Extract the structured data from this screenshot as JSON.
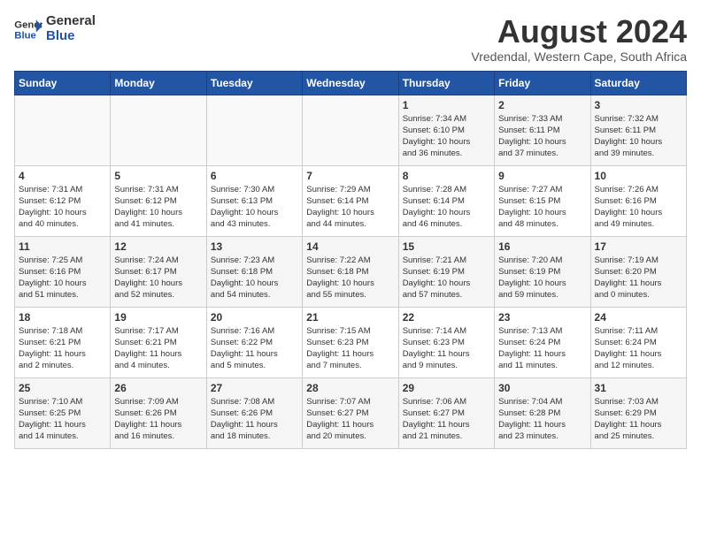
{
  "logo": {
    "text_general": "General",
    "text_blue": "Blue"
  },
  "title": {
    "month_year": "August 2024",
    "location": "Vredendal, Western Cape, South Africa"
  },
  "days_of_week": [
    "Sunday",
    "Monday",
    "Tuesday",
    "Wednesday",
    "Thursday",
    "Friday",
    "Saturday"
  ],
  "weeks": [
    [
      {
        "day": "",
        "info": ""
      },
      {
        "day": "",
        "info": ""
      },
      {
        "day": "",
        "info": ""
      },
      {
        "day": "",
        "info": ""
      },
      {
        "day": "1",
        "info": "Sunrise: 7:34 AM\nSunset: 6:10 PM\nDaylight: 10 hours\nand 36 minutes."
      },
      {
        "day": "2",
        "info": "Sunrise: 7:33 AM\nSunset: 6:11 PM\nDaylight: 10 hours\nand 37 minutes."
      },
      {
        "day": "3",
        "info": "Sunrise: 7:32 AM\nSunset: 6:11 PM\nDaylight: 10 hours\nand 39 minutes."
      }
    ],
    [
      {
        "day": "4",
        "info": "Sunrise: 7:31 AM\nSunset: 6:12 PM\nDaylight: 10 hours\nand 40 minutes."
      },
      {
        "day": "5",
        "info": "Sunrise: 7:31 AM\nSunset: 6:12 PM\nDaylight: 10 hours\nand 41 minutes."
      },
      {
        "day": "6",
        "info": "Sunrise: 7:30 AM\nSunset: 6:13 PM\nDaylight: 10 hours\nand 43 minutes."
      },
      {
        "day": "7",
        "info": "Sunrise: 7:29 AM\nSunset: 6:14 PM\nDaylight: 10 hours\nand 44 minutes."
      },
      {
        "day": "8",
        "info": "Sunrise: 7:28 AM\nSunset: 6:14 PM\nDaylight: 10 hours\nand 46 minutes."
      },
      {
        "day": "9",
        "info": "Sunrise: 7:27 AM\nSunset: 6:15 PM\nDaylight: 10 hours\nand 48 minutes."
      },
      {
        "day": "10",
        "info": "Sunrise: 7:26 AM\nSunset: 6:16 PM\nDaylight: 10 hours\nand 49 minutes."
      }
    ],
    [
      {
        "day": "11",
        "info": "Sunrise: 7:25 AM\nSunset: 6:16 PM\nDaylight: 10 hours\nand 51 minutes."
      },
      {
        "day": "12",
        "info": "Sunrise: 7:24 AM\nSunset: 6:17 PM\nDaylight: 10 hours\nand 52 minutes."
      },
      {
        "day": "13",
        "info": "Sunrise: 7:23 AM\nSunset: 6:18 PM\nDaylight: 10 hours\nand 54 minutes."
      },
      {
        "day": "14",
        "info": "Sunrise: 7:22 AM\nSunset: 6:18 PM\nDaylight: 10 hours\nand 55 minutes."
      },
      {
        "day": "15",
        "info": "Sunrise: 7:21 AM\nSunset: 6:19 PM\nDaylight: 10 hours\nand 57 minutes."
      },
      {
        "day": "16",
        "info": "Sunrise: 7:20 AM\nSunset: 6:19 PM\nDaylight: 10 hours\nand 59 minutes."
      },
      {
        "day": "17",
        "info": "Sunrise: 7:19 AM\nSunset: 6:20 PM\nDaylight: 11 hours\nand 0 minutes."
      }
    ],
    [
      {
        "day": "18",
        "info": "Sunrise: 7:18 AM\nSunset: 6:21 PM\nDaylight: 11 hours\nand 2 minutes."
      },
      {
        "day": "19",
        "info": "Sunrise: 7:17 AM\nSunset: 6:21 PM\nDaylight: 11 hours\nand 4 minutes."
      },
      {
        "day": "20",
        "info": "Sunrise: 7:16 AM\nSunset: 6:22 PM\nDaylight: 11 hours\nand 5 minutes."
      },
      {
        "day": "21",
        "info": "Sunrise: 7:15 AM\nSunset: 6:23 PM\nDaylight: 11 hours\nand 7 minutes."
      },
      {
        "day": "22",
        "info": "Sunrise: 7:14 AM\nSunset: 6:23 PM\nDaylight: 11 hours\nand 9 minutes."
      },
      {
        "day": "23",
        "info": "Sunrise: 7:13 AM\nSunset: 6:24 PM\nDaylight: 11 hours\nand 11 minutes."
      },
      {
        "day": "24",
        "info": "Sunrise: 7:11 AM\nSunset: 6:24 PM\nDaylight: 11 hours\nand 12 minutes."
      }
    ],
    [
      {
        "day": "25",
        "info": "Sunrise: 7:10 AM\nSunset: 6:25 PM\nDaylight: 11 hours\nand 14 minutes."
      },
      {
        "day": "26",
        "info": "Sunrise: 7:09 AM\nSunset: 6:26 PM\nDaylight: 11 hours\nand 16 minutes."
      },
      {
        "day": "27",
        "info": "Sunrise: 7:08 AM\nSunset: 6:26 PM\nDaylight: 11 hours\nand 18 minutes."
      },
      {
        "day": "28",
        "info": "Sunrise: 7:07 AM\nSunset: 6:27 PM\nDaylight: 11 hours\nand 20 minutes."
      },
      {
        "day": "29",
        "info": "Sunrise: 7:06 AM\nSunset: 6:27 PM\nDaylight: 11 hours\nand 21 minutes."
      },
      {
        "day": "30",
        "info": "Sunrise: 7:04 AM\nSunset: 6:28 PM\nDaylight: 11 hours\nand 23 minutes."
      },
      {
        "day": "31",
        "info": "Sunrise: 7:03 AM\nSunset: 6:29 PM\nDaylight: 11 hours\nand 25 minutes."
      }
    ]
  ]
}
